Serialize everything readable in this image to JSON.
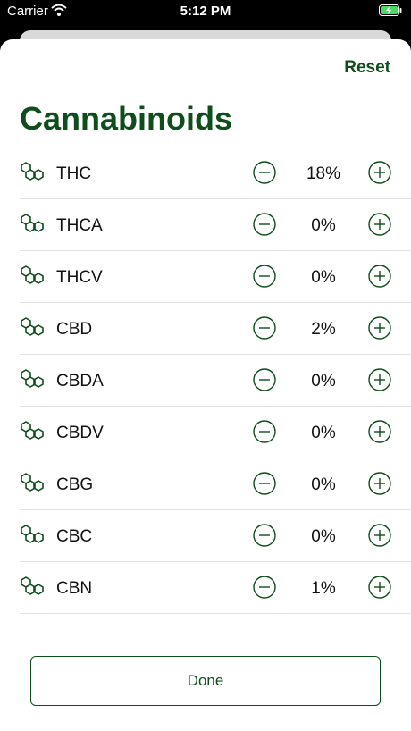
{
  "status_bar": {
    "carrier": "Carrier",
    "time": "5:12 PM",
    "wifi_icon": "wifi-icon",
    "battery_icon": "battery-charging-icon",
    "battery_color": "#4cd964"
  },
  "header": {
    "reset_label": "Reset",
    "title": "Cannabinoids"
  },
  "cannabinoids": [
    {
      "name": "THC",
      "value": "18%"
    },
    {
      "name": "THCA",
      "value": "0%"
    },
    {
      "name": "THCV",
      "value": "0%"
    },
    {
      "name": "CBD",
      "value": "2%"
    },
    {
      "name": "CBDA",
      "value": "0%"
    },
    {
      "name": "CBDV",
      "value": "0%"
    },
    {
      "name": "CBG",
      "value": "0%"
    },
    {
      "name": "CBC",
      "value": "0%"
    },
    {
      "name": "CBN",
      "value": "1%"
    }
  ],
  "row_icons": {
    "molecule": "molecule-icon",
    "decrement": "minus-circle-icon",
    "increment": "plus-circle-icon"
  },
  "footer": {
    "done_label": "Done"
  },
  "colors": {
    "accent": "#0e4d1c",
    "separator": "#e2e2e2"
  }
}
